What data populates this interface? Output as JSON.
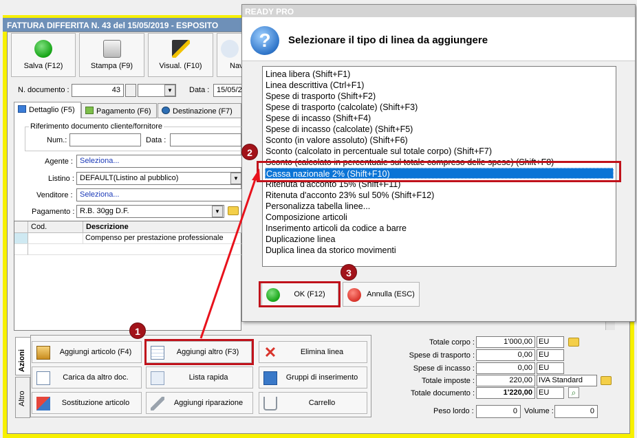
{
  "main_window": {
    "title": "FATTURA DIFFERITA N. 43 del 15/05/2019 - ESPOSITO",
    "toolbar": [
      {
        "label": "Salva (F12)",
        "icon": "check-icon"
      },
      {
        "label": "Stampa (F9)",
        "icon": "printer-icon"
      },
      {
        "label": "Visual. (F10)",
        "icon": "magic-wand-icon"
      },
      {
        "label": "Nav",
        "icon": "navigation-icon"
      }
    ],
    "ndoc_label": "N. documento :",
    "ndoc_value": "43",
    "data_label": "Data :",
    "data_value": "15/05/2",
    "tabs": [
      {
        "label": "Dettaglio (F5)",
        "icon": "table-icon"
      },
      {
        "label": "Pagamento (F6)",
        "icon": "money-icon"
      },
      {
        "label": "Destinazione (F7)",
        "icon": "globe-icon"
      }
    ],
    "rif_legend": "Riferimento documento cliente/fornitore",
    "num_label": "Num.:",
    "data2_label": "Data :",
    "agente_label": "Agente :",
    "agente_value": "Seleziona...",
    "listino_label": "Listino :",
    "listino_value": "DEFAULT(Listino al pubblico)",
    "venditore_label": "Venditore :",
    "venditore_value": "Seleziona...",
    "pagamento_label": "Pagamento :",
    "pagamento_value": "R.B. 30gg D.F.",
    "grid": {
      "headers": [
        "Cod.",
        "Descrizione"
      ],
      "rows": [
        [
          "",
          "Compenso per prestazione professionale"
        ]
      ]
    },
    "side_tabs": [
      "Azioni",
      "Altro"
    ],
    "actions": [
      {
        "label": "Aggiungi articolo (F4)",
        "icon": "box-add-icon"
      },
      {
        "label": "Aggiungi altro (F3)",
        "icon": "table-add-icon"
      },
      {
        "label": "Elimina linea",
        "icon": "delete-x-icon"
      },
      {
        "label": "Carica da altro doc.",
        "icon": "load-doc-icon"
      },
      {
        "label": "Lista rapida",
        "icon": "quick-list-icon"
      },
      {
        "label": "Gruppi di inserimento",
        "icon": "groups-icon"
      },
      {
        "label": "Sostituzione articolo",
        "icon": "replace-icon"
      },
      {
        "label": "Aggiungi riparazione",
        "icon": "wrench-icon"
      },
      {
        "label": "Carrello",
        "icon": "cart-icon"
      }
    ],
    "totals": [
      {
        "label": "Totale corpo :",
        "value": "1'000,00",
        "unit": "EU"
      },
      {
        "label": "Spese di trasporto :",
        "value": "0,00",
        "unit": "EU"
      },
      {
        "label": "Spese di incasso :",
        "value": "0,00",
        "unit": "EU"
      },
      {
        "label": "Totale imposte :",
        "value": "220,00",
        "unit": "IVA Standard"
      },
      {
        "label": "Totale documento :",
        "value": "1'220,00",
        "unit": "EU"
      }
    ],
    "peso_label": "Peso lordo :",
    "peso_value": "0",
    "volume_label": "Volume :",
    "volume_value": "0"
  },
  "dialog": {
    "title": "READY PRO",
    "question": "Selezionare il tipo di linea da aggiungere",
    "items": [
      "Linea libera (Shift+F1)",
      "Linea descrittiva (Ctrl+F1)",
      "Spese di trasporto (Shift+F2)",
      "Spese di trasporto (calcolate) (Shift+F3)",
      "Spese di incasso (Shift+F4)",
      "Spese di incasso (calcolate) (Shift+F5)",
      "Sconto (in valore assoluto) (Shift+F6)",
      "Sconto (calcolato in percentuale sul totale corpo) (Shift+F7)",
      "Sconto (calcolato in percentuale sul totale compreso delle spese) (Shift+F8)",
      "Cassa nazionale 2% (Shift+F10)",
      "Ritenuta d'acconto 15% (Shift+F11)",
      "Ritenuta d'acconto 23% sul 50% (Shift+F12)",
      "Personalizza tabella linee...",
      "Composizione articoli",
      "Inserimento articoli da codice a barre",
      "Duplicazione linea",
      "Duplica linea da storico movimenti"
    ],
    "selected_index": 9,
    "ok_label": "OK (F12)",
    "cancel_label": "Annulla (ESC)"
  },
  "markers": [
    "1",
    "2",
    "3"
  ],
  "colors": {
    "window_frame": "#f7f000",
    "selection": "#0a74d6",
    "highlight": "#c0121b"
  }
}
